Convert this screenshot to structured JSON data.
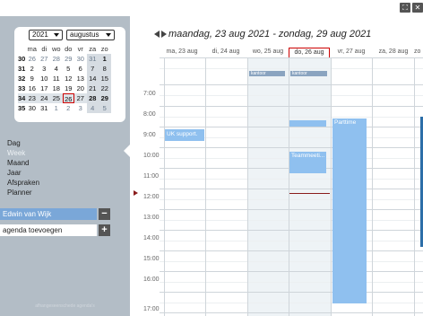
{
  "window": {
    "controls": [
      "⛶",
      "✕"
    ]
  },
  "mini_calendar": {
    "year": "2021",
    "month": "augustus",
    "weekday_headers": [
      "ma",
      "di",
      "wo",
      "do",
      "vr",
      "za",
      "zo"
    ],
    "weeks": [
      {
        "wk": "30",
        "days": [
          "26",
          "27",
          "28",
          "29",
          "30",
          "31",
          "1"
        ]
      },
      {
        "wk": "31",
        "days": [
          "2",
          "3",
          "4",
          "5",
          "6",
          "7",
          "8"
        ]
      },
      {
        "wk": "32",
        "days": [
          "9",
          "10",
          "11",
          "12",
          "13",
          "14",
          "15"
        ]
      },
      {
        "wk": "33",
        "days": [
          "16",
          "17",
          "18",
          "19",
          "20",
          "21",
          "22"
        ]
      },
      {
        "wk": "34",
        "days": [
          "23",
          "24",
          "25",
          "26",
          "27",
          "28",
          "29"
        ]
      },
      {
        "wk": "35",
        "days": [
          "30",
          "31",
          "1",
          "2",
          "3",
          "4",
          "5"
        ]
      }
    ]
  },
  "nav": {
    "items": [
      "Dag",
      "Week",
      "Maand",
      "Jaar",
      "Afspraken",
      "Planner"
    ],
    "active": "Week"
  },
  "user": {
    "name": "Edwin van Wijk",
    "collapse_label": "−"
  },
  "add_agenda": {
    "label": "agenda toevoegen",
    "button_label": "+"
  },
  "footer": {
    "text": "afhangeseenschede agenda's"
  },
  "header": {
    "title": "maandag, 23 aug 2021 - zondag, 29 aug 2021",
    "days": [
      "ma, 23 aug",
      "di, 24 aug",
      "wo, 25 aug",
      "do, 26 aug",
      "vr, 27 aug",
      "za, 28 aug",
      "zo"
    ]
  },
  "hours": [
    "7:00",
    "8:00",
    "9:00",
    "10:00",
    "11:00",
    "12:00",
    "13:00",
    "14:00",
    "15:00",
    "16:00",
    "17:00"
  ],
  "allday_events": [
    {
      "label": "kantoor"
    },
    {
      "label": "kantoor"
    }
  ],
  "events": [
    {
      "label": "UK support."
    },
    {
      "label": "Teammeeti..."
    },
    {
      "label": "Parttime"
    },
    {
      "label": ""
    }
  ],
  "colors": {
    "accent": "#8fc0ef",
    "today_border": "#cc0000",
    "sidebar": "#b3bdc6",
    "now_line": "#8a1c1c"
  }
}
